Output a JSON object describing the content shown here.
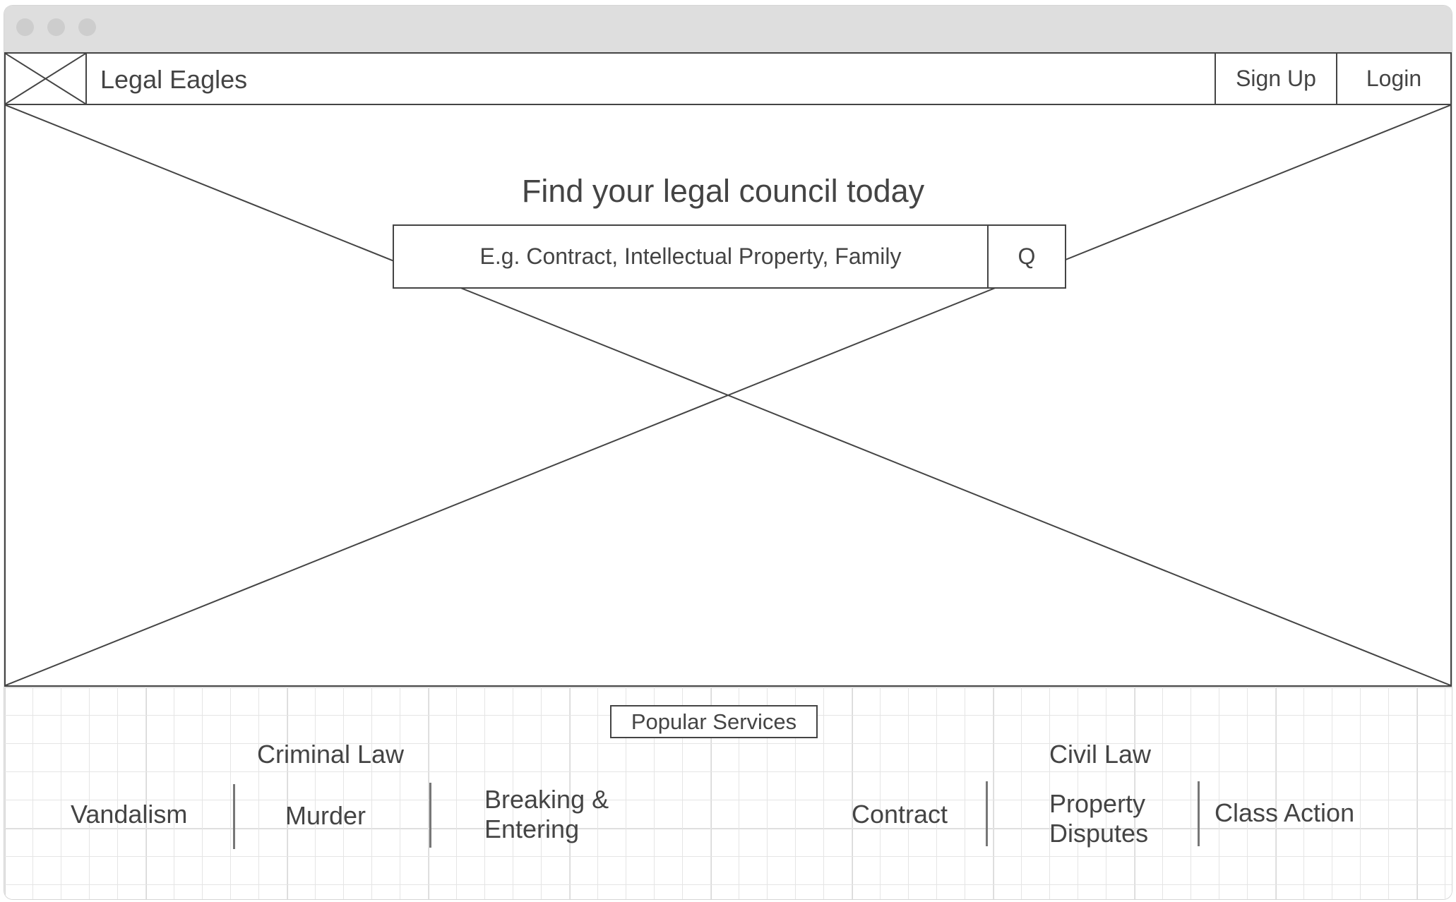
{
  "navbar": {
    "brand": "Legal Eagles",
    "signup_label": "Sign Up",
    "login_label": "Login"
  },
  "hero": {
    "title": "Find your legal council today",
    "search_placeholder": "E.g. Contract, Intellectual Property, Family",
    "search_button_label": "Q"
  },
  "services": {
    "heading": "Popular Services",
    "categories": [
      {
        "title": "Criminal Law",
        "items": [
          "Vandalism",
          "Murder",
          "Breaking & Entering"
        ]
      },
      {
        "title": "Civil Law",
        "items": [
          "Contract",
          "Property Disputes",
          "Class Action"
        ]
      }
    ]
  },
  "colors": {
    "stroke": "#444444",
    "titlebar": "#dedede",
    "window_dot": "#cdcdcd",
    "grid_line": "#e5e5e5"
  }
}
